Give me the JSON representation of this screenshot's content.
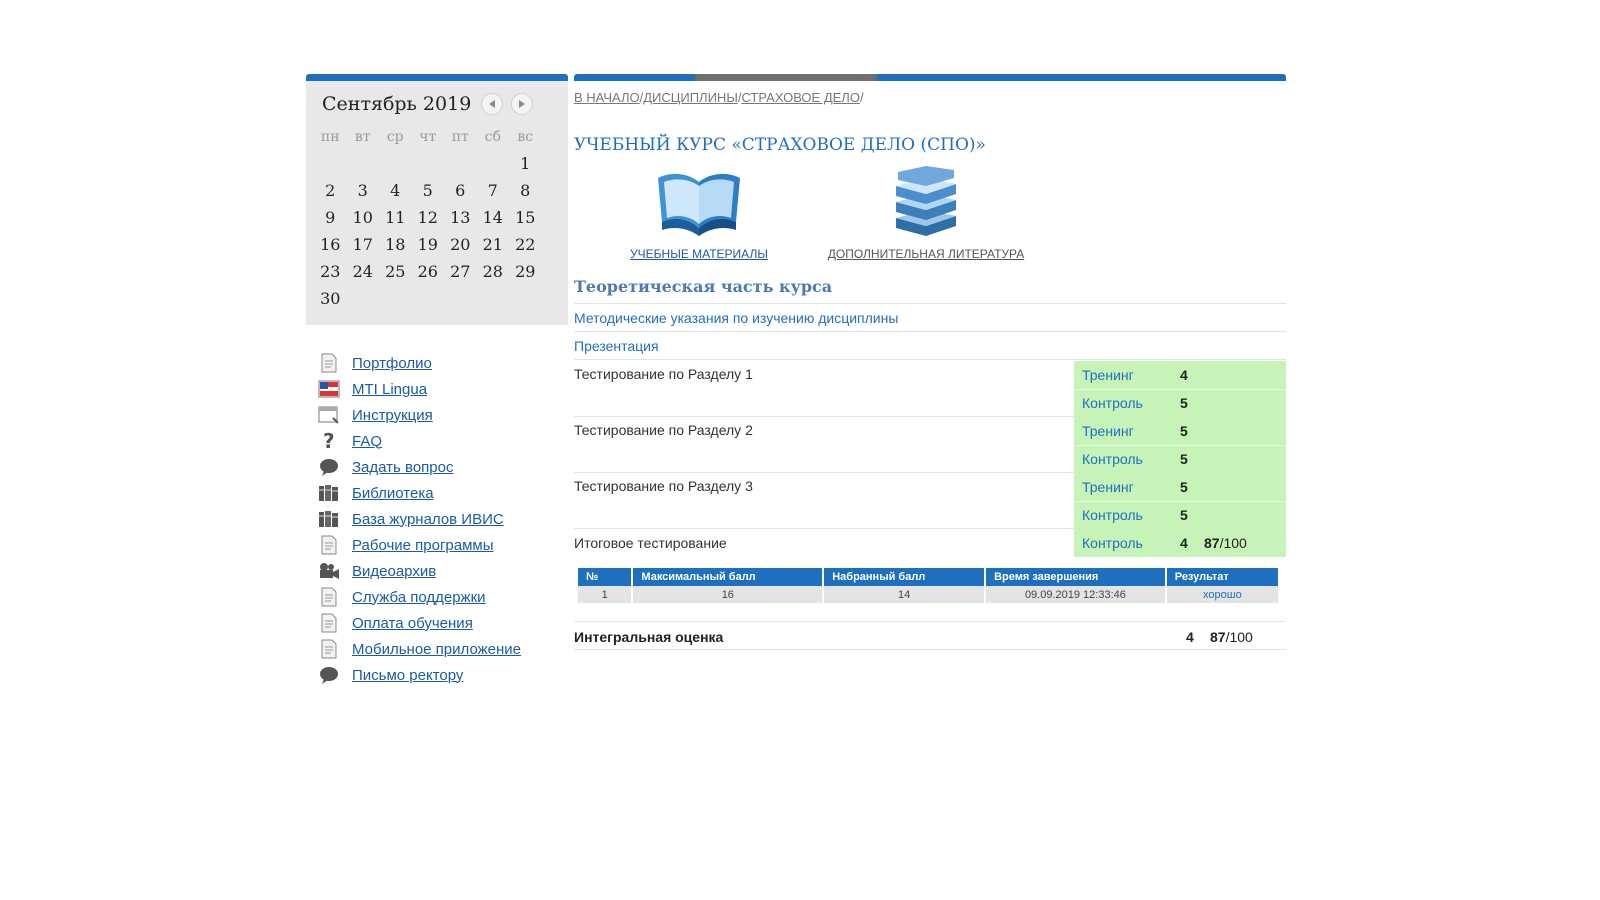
{
  "calendar": {
    "title": "Сентябрь 2019",
    "weekdays": [
      "пн",
      "вт",
      "ср",
      "чт",
      "пт",
      "сб",
      "вс"
    ],
    "weeks": [
      [
        "",
        "",
        "",
        "",
        "",
        "",
        "1"
      ],
      [
        "2",
        "3",
        "4",
        "5",
        "6",
        "7",
        "8"
      ],
      [
        "9",
        "10",
        "11",
        "12",
        "13",
        "14",
        "15"
      ],
      [
        "16",
        "17",
        "18",
        "19",
        "20",
        "21",
        "22"
      ],
      [
        "23",
        "24",
        "25",
        "26",
        "27",
        "28",
        "29"
      ],
      [
        "30",
        "",
        "",
        "",
        "",
        "",
        ""
      ]
    ]
  },
  "menu": [
    {
      "label": "Портфолио",
      "icon": "document-icon"
    },
    {
      "label": "MTI Lingua",
      "icon": "flag-icon"
    },
    {
      "label": "Инструкция",
      "icon": "window-icon"
    },
    {
      "label": "FAQ",
      "icon": "question-icon"
    },
    {
      "label": "Задать вопрос",
      "icon": "speech-bubble-icon"
    },
    {
      "label": "Библиотека",
      "icon": "books-icon"
    },
    {
      "label": "База журналов ИВИС",
      "icon": "books-icon"
    },
    {
      "label": "Рабочие программы",
      "icon": "document-icon"
    },
    {
      "label": "Видеоархив",
      "icon": "video-camera-icon"
    },
    {
      "label": "Служба поддержки",
      "icon": "document-icon"
    },
    {
      "label": "Оплата обучения",
      "icon": "document-icon"
    },
    {
      "label": "Мобильное приложение",
      "icon": "document-icon"
    },
    {
      "label": "Письмо ректору",
      "icon": "speech-bubble-icon"
    }
  ],
  "breadcrumb": {
    "items": [
      "В НАЧАЛО",
      "ДИСЦИПЛИНЫ",
      "СТРАХОВОЕ ДЕЛО"
    ],
    "separator": "/"
  },
  "course": {
    "title": "УЧЕБНЫЙ КУРС «СТРАХОВОЕ ДЕЛО (СПО)»",
    "resources": [
      {
        "label": "УЧЕБНЫЕ МАТЕРИАЛЫ",
        "icon": "open-book-icon"
      },
      {
        "label": "ДОПОЛНИТЕЛЬНАЯ ЛИТЕРАТУРА",
        "icon": "book-stack-icon"
      }
    ]
  },
  "theory": {
    "title": "Теоретическая часть курса",
    "links": [
      "Методические указания по изучению дисциплины",
      "Презентация"
    ]
  },
  "tests": [
    {
      "label": "Тестирование по Разделу 1",
      "rows": [
        {
          "type": "Тренинг",
          "grade": "4"
        },
        {
          "type": "Контроль",
          "grade": "5"
        }
      ]
    },
    {
      "label": "Тестирование по Разделу 2",
      "rows": [
        {
          "type": "Тренинг",
          "grade": "5"
        },
        {
          "type": "Контроль",
          "grade": "5"
        }
      ]
    },
    {
      "label": "Тестирование по Разделу 3",
      "rows": [
        {
          "type": "Тренинг",
          "grade": "5"
        },
        {
          "type": "Контроль",
          "grade": "5"
        }
      ]
    }
  ],
  "final_test": {
    "label": "Итоговое тестирование",
    "type": "Контроль",
    "grade": "4",
    "points": "87",
    "max": "/100"
  },
  "attempts": {
    "headers": [
      "№",
      "Максимальный балл",
      "Набранный балл",
      "Время завершения",
      "Результат"
    ],
    "rows": [
      [
        "1",
        "16",
        "14",
        "09.09.2019 12:33:46",
        "хорошо"
      ]
    ]
  },
  "integral": {
    "label": "Интегральная оценка",
    "grade": "4",
    "points": "87",
    "max": "/100"
  },
  "colors": {
    "accent": "#1f6fbf",
    "score_background": "#c6f3b7",
    "calendar_background": "#e8e8e8"
  }
}
